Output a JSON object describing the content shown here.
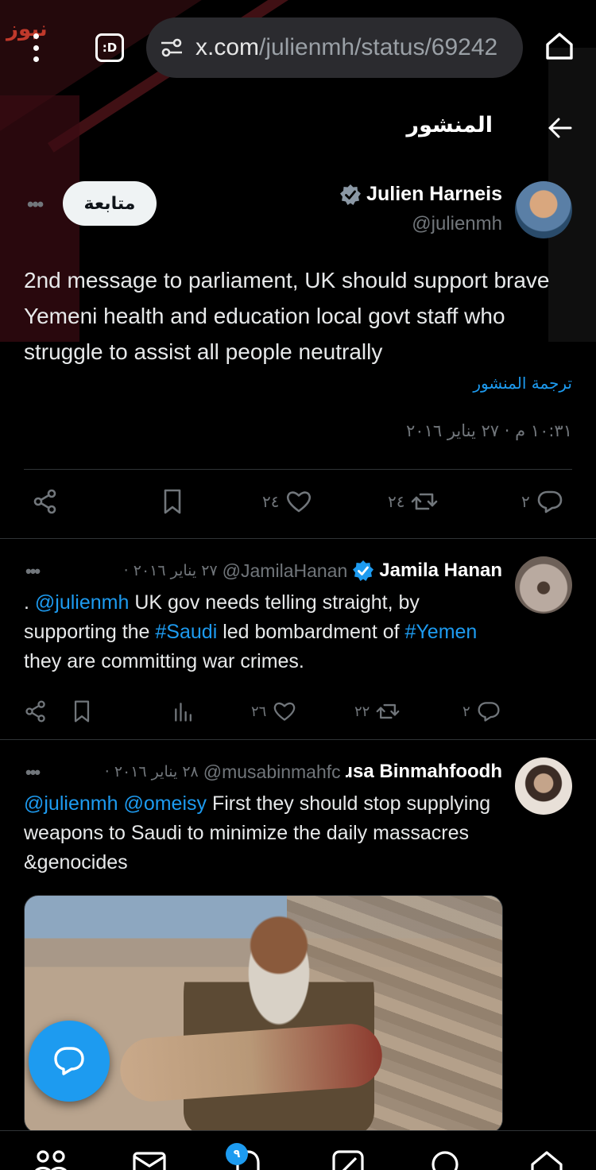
{
  "browser": {
    "logo_text": "نيوز",
    "tab_count": ":D",
    "url_main": "x.com",
    "url_path": "/julienmh/status/69242"
  },
  "header": {
    "title": "المنشور"
  },
  "main_tweet": {
    "author_name": "Julien Harneis",
    "handle": "@julienmh",
    "follow_label": "متابعة",
    "more_label": "•••",
    "text": "2nd message to parliament, UK should support brave Yemeni health and education local govt staff who struggle to assist all  people neutrally",
    "translate_label": "ترجمة المنشور",
    "timestamp": "١٠:٣١ م · ٢٧ يناير ٢٠١٦",
    "replies": "٢",
    "reposts": "٢٤",
    "likes": "٢٤"
  },
  "replies": [
    {
      "name": "Jamila Hanan",
      "handle": "@JamilaHanan",
      "date": "· ٢٧ يناير ٢٠١٦",
      "more_label": "•••",
      "text_prefix": ". ",
      "mention": "@julienmh",
      "text_1": " UK gov needs telling straight, by supporting the ",
      "hashtag_1": "#Saudi",
      "text_2": " led bombardment of ",
      "hashtag_2": "#Yemen",
      "text_3": " they are committing war crimes.",
      "replies": "٢",
      "reposts": "٢٢",
      "likes": "٢٦"
    },
    {
      "name": "ɹsa Binmahfoodh",
      "handle": "@musabinmahfc",
      "date": "· ٢٨ يناير ٢٠١٦",
      "more_label": "•••",
      "mention_1": "@julienmh",
      "mention_2": "@omeisy",
      "text": " First they should stop supplying weapons to Saudi to minimize the daily massacres &genocides"
    }
  ],
  "bottom_nav": {
    "notification_badge": "٩"
  },
  "colors": {
    "accent": "#1d9bf0",
    "background": "#000000",
    "muted": "#71767b"
  }
}
